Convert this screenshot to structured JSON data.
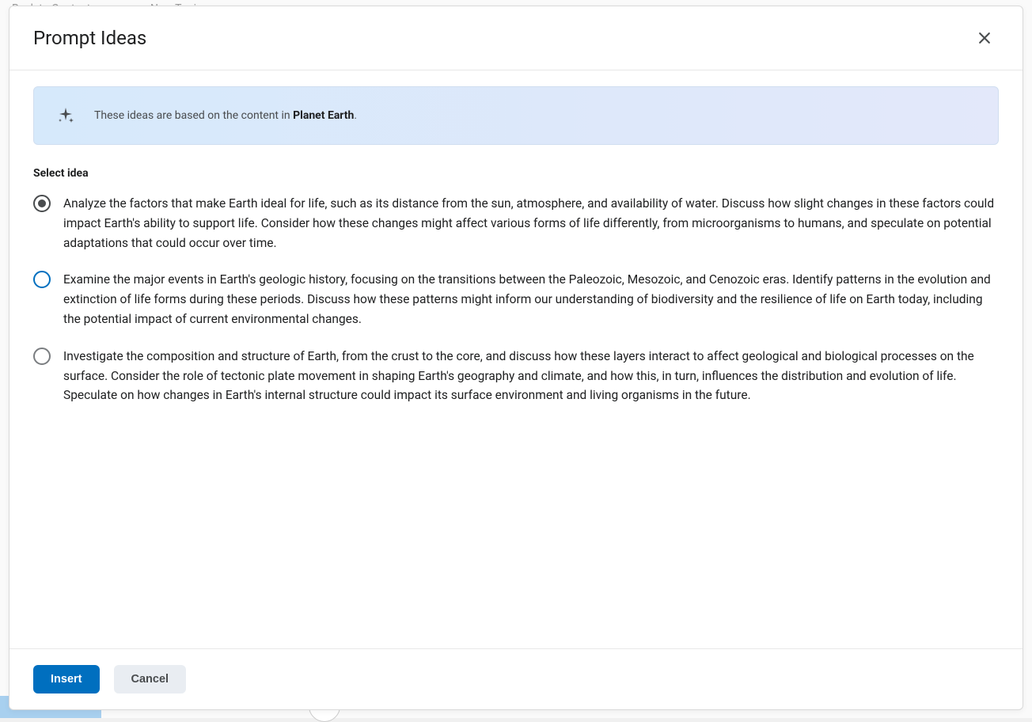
{
  "background": {
    "breadcrumb1": "Back to Content",
    "breadcrumb2": "New Topic"
  },
  "modal": {
    "title": "Prompt Ideas",
    "banner": {
      "prefix": "These ideas are based on the content in ",
      "source": "Planet Earth",
      "suffix": "."
    },
    "select_label": "Select idea",
    "ideas": [
      {
        "text": "Analyze the factors that make Earth ideal for life, such as its distance from the sun, atmosphere, and availability of water. Discuss how slight changes in these factors could impact Earth's ability to support life. Consider how these changes might affect various forms of life differently, from microorganisms to humans, and speculate on potential adaptations that could occur over time.",
        "state": "selected"
      },
      {
        "text": "Examine the major events in Earth's geologic history, focusing on the transitions between the Paleozoic, Mesozoic, and Cenozoic eras. Identify patterns in the evolution and extinction of life forms during these periods. Discuss how these patterns might inform our understanding of biodiversity and the resilience of life on Earth today, including the potential impact of current environmental changes.",
        "state": "highlighted"
      },
      {
        "text": "Investigate the composition and structure of Earth, from the crust to the core, and discuss how these layers interact to affect geological and biological processes on the surface. Consider the role of tectonic plate movement in shaping Earth's geography and climate, and how this, in turn, influences the distribution and evolution of life. Speculate on how changes in Earth's internal structure could impact its surface environment and living organisms in the future.",
        "state": "default"
      }
    ],
    "buttons": {
      "insert": "Insert",
      "cancel": "Cancel"
    }
  }
}
